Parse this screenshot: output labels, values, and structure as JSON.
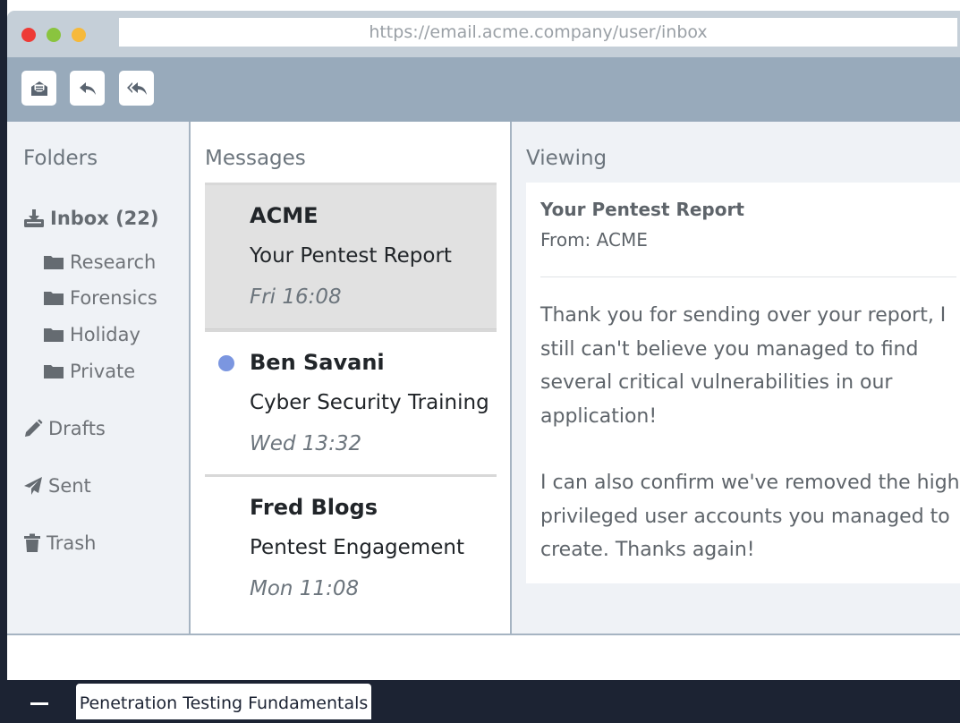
{
  "browser": {
    "url": "https://email.acme.company/user/inbox"
  },
  "toolbar": {
    "buttons": [
      {
        "icon": "envelope-open-icon"
      },
      {
        "icon": "reply-icon"
      },
      {
        "icon": "reply-all-icon"
      }
    ]
  },
  "folders": {
    "heading": "Folders",
    "inbox": {
      "label": "Inbox (22)",
      "icon": "inbox-download-icon"
    },
    "subfolders": [
      {
        "label": "Research",
        "icon": "folder-icon"
      },
      {
        "label": "Forensics",
        "icon": "folder-icon"
      },
      {
        "label": "Holiday",
        "icon": "folder-icon"
      },
      {
        "label": "Private",
        "icon": "folder-icon"
      }
    ],
    "drafts": {
      "label": "Drafts",
      "icon": "pencil-icon"
    },
    "sent": {
      "label": "Sent",
      "icon": "paper-plane-icon"
    },
    "trash": {
      "label": "Trash",
      "icon": "trash-icon"
    }
  },
  "messages": {
    "heading": "Messages",
    "items": [
      {
        "sender": "ACME",
        "subject": "Your Pentest Report",
        "time": "Fri 16:08",
        "selected": true,
        "unread": false
      },
      {
        "sender": "Ben Savani",
        "subject": "Cyber Security Training",
        "time": "Wed 13:32",
        "selected": false,
        "unread": true
      },
      {
        "sender": "Fred Blogs",
        "subject": "Pentest Engagement",
        "time": "Mon 11:08",
        "selected": false,
        "unread": false
      }
    ]
  },
  "viewing": {
    "heading": "Viewing",
    "subject": "Your Pentest Report",
    "from": "From: ACME",
    "body": [
      "Thank you for sending over your report, I still can't believe you managed to find several critical vulnerabilities in our application!",
      "I can also confirm we've removed the high privileged user accounts you managed to create. Thanks again!"
    ]
  },
  "taskbar": {
    "tab_label": "Penetration Testing Fundamentals"
  },
  "colors": {
    "toolbar": "#98aabb",
    "titlebar": "#c5cfd8",
    "unread_dot": "#7b96e0",
    "taskbar": "#1c2333"
  }
}
